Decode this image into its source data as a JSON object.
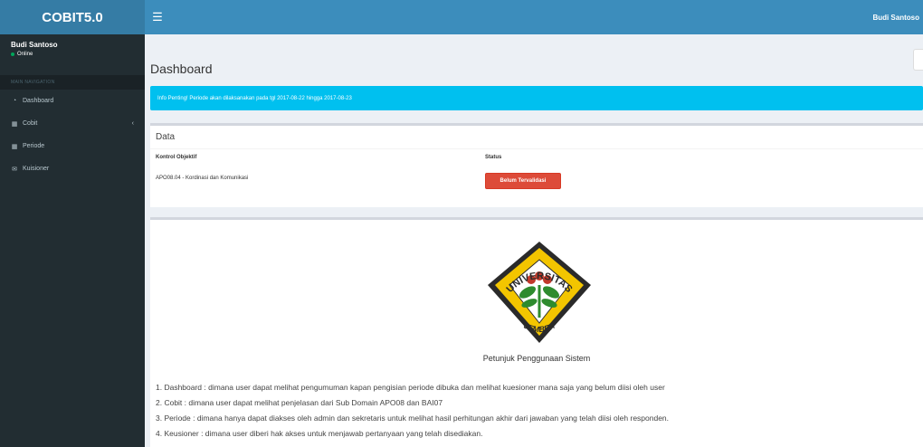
{
  "header": {
    "brand": "COBIT5.0",
    "user": "Budi Santoso"
  },
  "sidebar": {
    "user_name": "Budi Santoso",
    "user_status": "Online",
    "nav_header": "MAIN NAVIGATION",
    "items": [
      {
        "label": "Dashboard",
        "icon": "dashboard-icon"
      },
      {
        "label": "Cobit",
        "icon": "table-icon"
      },
      {
        "label": "Periode",
        "icon": "calendar-icon"
      },
      {
        "label": "Kuisioner",
        "icon": "envelope-icon"
      }
    ]
  },
  "page": {
    "title": "Dashboard",
    "alert": "Info Penting! Periode akan dilaksanakan pada tgl 2017-08-22 hingga 2017-08-23"
  },
  "data_box": {
    "title": "Data",
    "col_kontrol": "Kontrol Objektif",
    "col_status": "Status",
    "rows": [
      {
        "kontrol": "APO08.04 - Kordinasi dan Komunikasi",
        "status": "Belum Tervalidasi"
      }
    ]
  },
  "logo": {
    "top_text": "UNIVERSITAS",
    "bottom_text": "JEMBER",
    "colors": {
      "outer": "#2a2a2a",
      "fill": "#f3c500",
      "leaf": "#2e8b2e",
      "flower": "#c0392b"
    }
  },
  "instructions": {
    "title": "Petunjuk Penggunaan Sistem",
    "steps": [
      "1. Dashboard : dimana user dapat melihat pengumuman kapan pengisian periode dibuka dan melihat kuesioner mana saja yang belum diisi oleh user",
      "2. Cobit : dimana user dapat melihat penjelasan dari Sub Domain APO08 dan BAI07",
      "3. Periode : dimana hanya dapat diakses oleh admin dan sekretaris untuk melihat hasil perhitungan akhir dari jawaban yang telah diisi oleh responden.",
      "4. Keusioner : dimana user diberi hak akses untuk menjawab pertanyaan yang telah disediakan."
    ]
  }
}
